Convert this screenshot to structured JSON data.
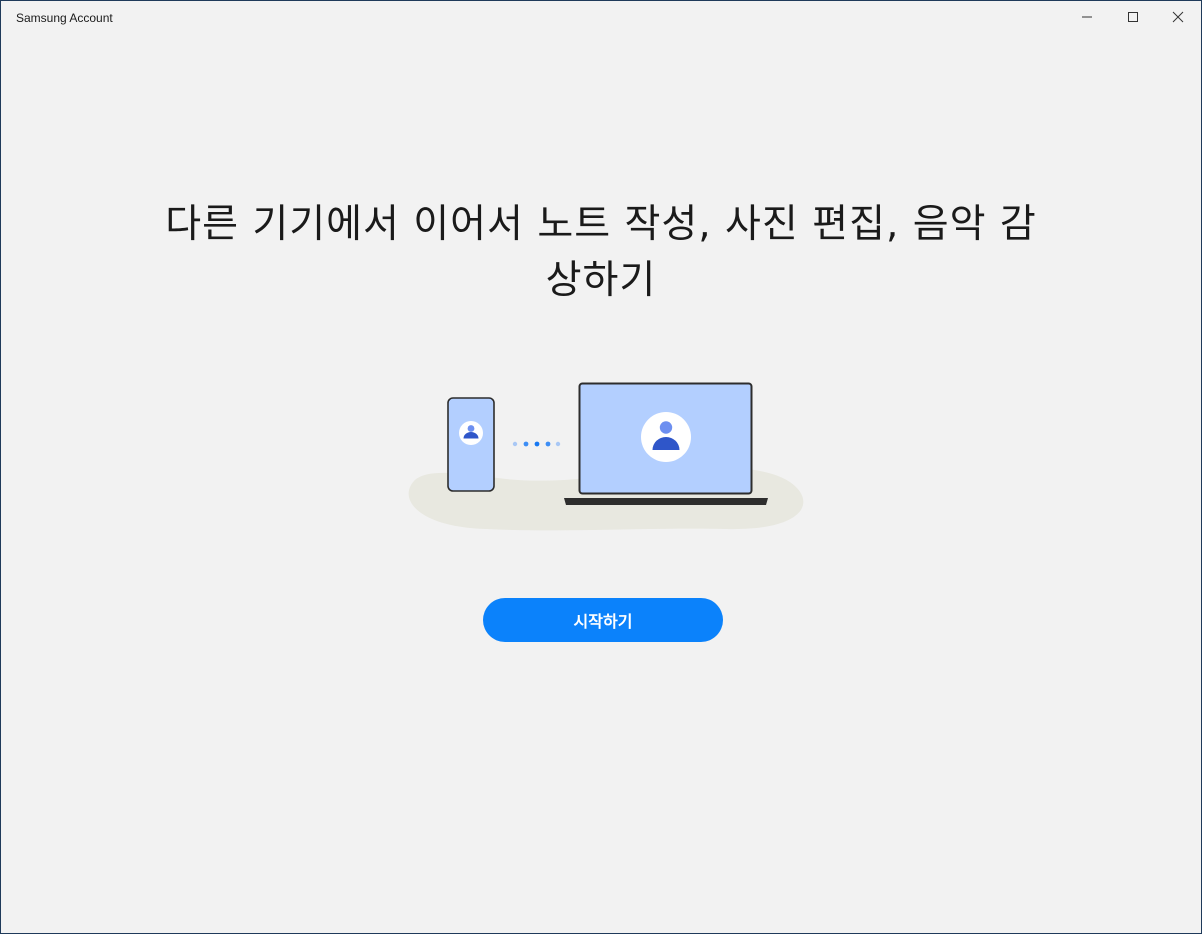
{
  "window": {
    "title": "Samsung Account",
    "controls": {
      "minimize_icon": "minimize-icon",
      "maximize_icon": "maximize-icon",
      "close_icon": "close-icon"
    }
  },
  "main": {
    "headline_line1": "다른 기기에서 이어서 노트 작성, 사진 편집, 음악 감",
    "headline_line2": "상하기",
    "start_button_label": "시작하기"
  },
  "illustration": {
    "icons": [
      "phone-icon",
      "laptop-icon",
      "user-avatar-icon",
      "connection-dots-icon"
    ]
  },
  "colors": {
    "background": "#f2f2f2",
    "accent": "#0b82fb",
    "screen": "#b3cfff",
    "avatar": "#2f56c9",
    "avatar_head": "#6d8ff0",
    "blob": "#e8e8e0",
    "device_frame": "#2d2d2d"
  }
}
